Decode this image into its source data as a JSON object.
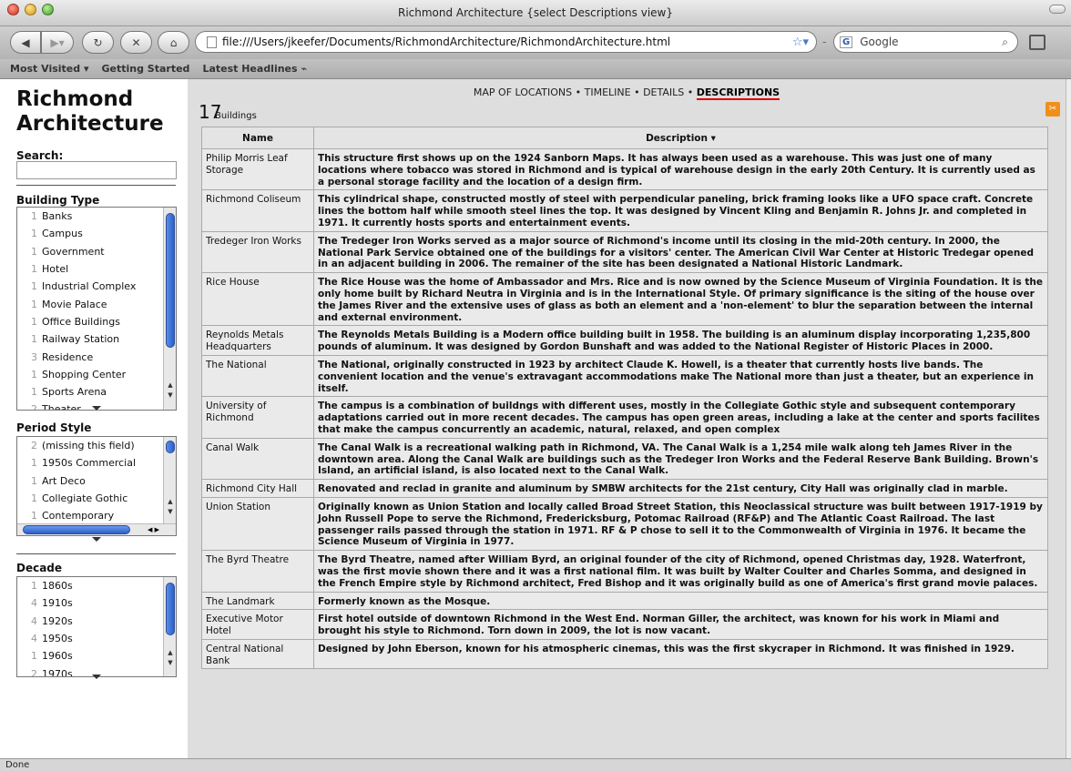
{
  "window": {
    "title": "Richmond Architecture {select Descriptions view}"
  },
  "toolbar": {
    "url": "file:///Users/jkeefer/Documents/RichmondArchitecture/RichmondArchitecture.html",
    "search_placeholder": "Google",
    "search_engine": "G"
  },
  "bookmarks": [
    "Most Visited ▾",
    "Getting Started",
    "Latest Headlines ⌁"
  ],
  "sidebar": {
    "title_line1": "Richmond",
    "title_line2": "Architecture",
    "search_label": "Search:",
    "building_type": {
      "label": "Building Type",
      "items": [
        {
          "count": "1",
          "label": "Banks"
        },
        {
          "count": "1",
          "label": "Campus"
        },
        {
          "count": "1",
          "label": "Government"
        },
        {
          "count": "1",
          "label": "Hotel"
        },
        {
          "count": "1",
          "label": "Industrial Complex"
        },
        {
          "count": "1",
          "label": "Movie Palace"
        },
        {
          "count": "1",
          "label": "Office Buildings"
        },
        {
          "count": "1",
          "label": "Railway Station"
        },
        {
          "count": "3",
          "label": "Residence"
        },
        {
          "count": "1",
          "label": "Shopping Center"
        },
        {
          "count": "1",
          "label": "Sports Arena"
        },
        {
          "count": "2",
          "label": "Theater"
        }
      ]
    },
    "period_style": {
      "label": "Period Style",
      "items": [
        {
          "count": "2",
          "label": "(missing this field)"
        },
        {
          "count": "1",
          "label": "1950s Commercial"
        },
        {
          "count": "1",
          "label": "Art Deco"
        },
        {
          "count": "1",
          "label": "Collegiate Gothic"
        },
        {
          "count": "1",
          "label": "Contemporary"
        }
      ]
    },
    "decade": {
      "label": "Decade",
      "items": [
        {
          "count": "1",
          "label": "1860s"
        },
        {
          "count": "4",
          "label": "1910s"
        },
        {
          "count": "4",
          "label": "1920s"
        },
        {
          "count": "4",
          "label": "1950s"
        },
        {
          "count": "1",
          "label": "1960s"
        },
        {
          "count": "2",
          "label": "1970s"
        }
      ]
    }
  },
  "main": {
    "views": [
      "MAP OF LOCATIONS",
      "TIMELINE",
      "DETAILS",
      "DESCRIPTIONS"
    ],
    "active_view": "DESCRIPTIONS",
    "count": "17",
    "count_label": "Buildings",
    "col_name": "Name",
    "col_desc": "Description ▾",
    "rows": [
      {
        "name": "Philip Morris Leaf Storage",
        "desc": "This structure first shows up on the 1924 Sanborn Maps. It has always been used as a warehouse. This was just one of many locations where tobacco was stored in Richmond and is typical of warehouse design in the early 20th Century. It is currently used as a personal storage facility and the location of a design firm."
      },
      {
        "name": "Richmond Coliseum",
        "desc": "This cylindrical shape, constructed mostly of steel with perpendicular paneling, brick framing looks like a UFO space craft. Concrete lines the bottom half while smooth steel lines the top. It was designed by Vincent Kling and Benjamin R. Johns Jr. and completed in 1971. It currently hosts sports and entertainment events."
      },
      {
        "name": "Tredeger Iron Works",
        "desc": "The Tredeger Iron Works served as a major source of Richmond's income until its closing in the mid-20th century. In 2000, the National Park Service obtained one of the buildings for a visitors' center. The American Civil War Center at Historic Tredegar opened in an adjacent building in 2006. The remainer of the site has been designated a National Historic Landmark."
      },
      {
        "name": "Rice House",
        "desc": "The Rice House was the home of Ambassador and Mrs. Rice and is now owned by the Science Museum of Virginia Foundation. It is the only home built by Richard Neutra in Virginia and is in the International Style. Of primary significance is the siting of the house over the James River and the extensive uses of glass as both an element and a 'non-element' to blur the separation between the internal and external environment."
      },
      {
        "name": "Reynolds Metals Headquarters",
        "desc": "The Reynolds Metals Building is a Modern office building built in 1958. The building is an aluminum display incorporating 1,235,800 pounds of aluminum. It was designed by Gordon Bunshaft and was added to the National Register of Historic Places in 2000."
      },
      {
        "name": "The National",
        "desc": "The National, originally constructed in 1923 by architect Claude K. Howell, is a theater that currently hosts live bands. The convenient location and the venue's extravagant accommodations make The National more than just a theater, but an experience in itself."
      },
      {
        "name": "University of Richmond",
        "desc": "The campus is a combination of buildngs with different uses, mostly in the Collegiate Gothic style and subsequent contemporary adaptations carried out in more recent decades. The campus has open green areas, including a lake at the center and sports facilites that make the campus concurrently an academic, natural, relaxed, and open complex"
      },
      {
        "name": "Canal Walk",
        "desc": "The Canal Walk is a recreational walking path in Richmond, VA. The Canal Walk is a 1,254 mile walk along teh James River in the downtown area. Along the Canal Walk are buildings such as the Tredeger Iron Works and the Federal Reserve Bank Building. Brown's Island, an artificial island, is also located next to the Canal Walk."
      },
      {
        "name": "Richmond City Hall",
        "desc": "Renovated and reclad in granite and aluminum by SMBW architects for the 21st century, City Hall was originally clad in marble."
      },
      {
        "name": "Union Station",
        "desc": "Originally known as Union Station and locally called Broad Street Station, this Neoclassical structure was built between 1917-1919 by John Russell Pope to serve the Richmond, Fredericksburg, Potomac Railroad (RF&P) and The Atlantic Coast Railroad. The last passenger rails passed through the station in 1971. RF & P chose to sell it to the Commonwealth of Virginia in 1976. It became the Science Museum of Virginia in 1977."
      },
      {
        "name": "The Byrd Theatre",
        "desc": "The Byrd Theatre, named after William Byrd, an original founder of the city of Richmond, opened Christmas day, 1928. Waterfront, was the first movie shown there and it was a first national film. It was built by Walter Coulter and Charles Somma, and designed in the French Empire style by Richmond architect, Fred Bishop and it was originally build as one of America's first grand movie palaces."
      },
      {
        "name": "The Landmark",
        "desc": "Formerly known as the Mosque."
      },
      {
        "name": "Executive Motor Hotel",
        "desc": "First hotel outside of downtown Richmond in the West End. Norman Giller, the architect, was known for his work in Miami and brought his style to Richmond. Torn down in 2009, the lot is now vacant."
      },
      {
        "name": "Central National Bank",
        "desc": "Designed by John Eberson, known for his atmospheric cinemas, this was the first skycraper in Richmond. It was finished in 1929."
      }
    ]
  },
  "status": "Done"
}
